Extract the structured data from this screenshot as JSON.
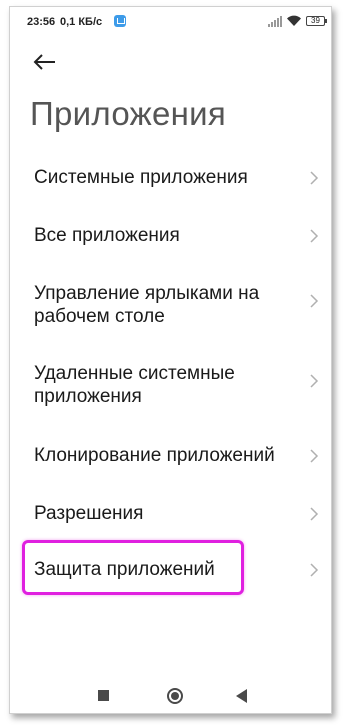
{
  "status_bar": {
    "time": "23:56",
    "speed": "0,1 КБ/с",
    "battery": "39"
  },
  "header": {
    "title": "Приложения"
  },
  "menu": {
    "items": [
      {
        "label": "Системные приложения"
      },
      {
        "label": "Все приложения"
      },
      {
        "label": "Управление ярлыками на рабочем столе"
      },
      {
        "label": "Удаленные системные приложения"
      },
      {
        "label": "Клонирование приложений"
      },
      {
        "label": "Разрешения"
      },
      {
        "label": "Защита приложений"
      }
    ]
  },
  "highlight_color": "#e020e0",
  "icons": {
    "back": "arrow-left-icon",
    "chevron": "chevron-right-icon",
    "nav_recents": "square-icon",
    "nav_home": "circle-icon",
    "nav_back": "triangle-back-icon"
  }
}
